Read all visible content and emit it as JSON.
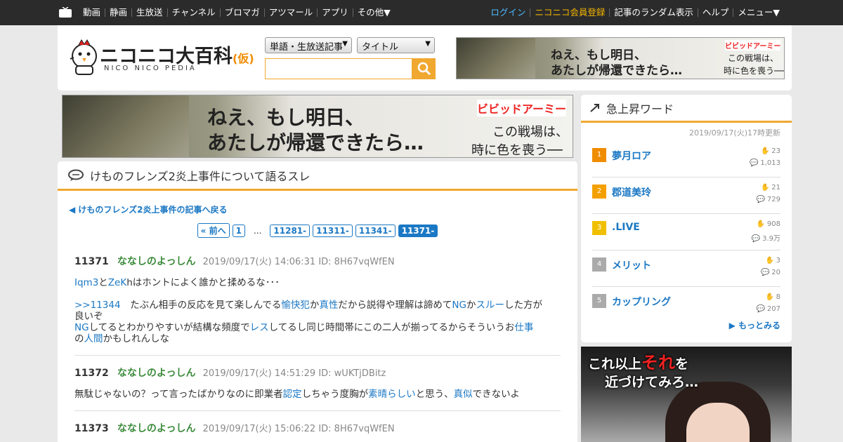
{
  "topnav": {
    "left": [
      "動画",
      "静画",
      "生放送",
      "チャンネル",
      "ブロマガ",
      "アツマール",
      "アプリ",
      "その他▼"
    ],
    "login": "ログイン",
    "register": "ニコニコ会員登録",
    "random": "記事のランダム表示",
    "help": "ヘルプ",
    "menu": "メニュー▼"
  },
  "logo": {
    "title": "ニコニコ大百科",
    "suffix": "(仮)",
    "sub": "NICO NICO PEDIA"
  },
  "search": {
    "scope": "単語・生放送記事",
    "field": "タイトル",
    "query": ""
  },
  "ad": {
    "line1": "ねえ、もし明日、",
    "line2": "あたしが帰還できたら…",
    "brand": "ビビッドアーミー",
    "tag1": "この戦場は、",
    "tag2": "時に色を喪う──"
  },
  "main": {
    "title": "けものフレンズ2炎上事件について語るスレ",
    "back": "◀ けものフレンズ2炎上事件の記事へ戻る",
    "pager": [
      "« 前へ",
      "1",
      "...",
      "11281-",
      "11311-",
      "11341-",
      "11371-"
    ],
    "posts": [
      {
        "num": "11371",
        "name": "ななしのよっしん",
        "meta": "2019/09/17(火) 14:06:31 ID: 8H67vqWfEN",
        "lines": [
          [
            "",
            "Iqm3",
            "と",
            "ZeK",
            "hはホントによく誰かと揉めるな･･･"
          ],
          [],
          [
            ">>11344",
            "　たぶん相手の反応を見て楽しんでる",
            "愉快犯",
            "か",
            "真性",
            "だから説得や理解は諦めて",
            "NG",
            "か",
            "スルー",
            "した方が"
          ],
          [
            "良いぞ"
          ],
          [
            "NG",
            "してるとわかりやすいが結構な頻度で",
            "レス",
            "してるし同じ時間帯にこの二人が揃ってるからそういうお",
            "仕事"
          ],
          [
            "の",
            "人間",
            "かもしれんしな"
          ]
        ]
      },
      {
        "num": "11372",
        "name": "ななしのよっしん",
        "meta": "2019/09/17(火) 14:51:29 ID: wUKTjDBitz",
        "lines": [
          [
            "無駄じゃないの？って言ったばかりなのに即業者",
            "認定",
            "しちゃう度胸が",
            "素晴らしい",
            "と思う、",
            "真似",
            "できないよ"
          ]
        ]
      },
      {
        "num": "11373",
        "name": "ななしのよっしん",
        "meta": "2019/09/17(火) 15:06:22 ID: 8H67vqWfEN",
        "lines": []
      }
    ]
  },
  "side": {
    "title": "急上昇ワード",
    "updated": "2019/09/17(火)17時更新",
    "ranks": [
      {
        "n": "1",
        "word": "夢月ロア",
        "a": "23",
        "b": "1,013",
        "color": "#f08c00"
      },
      {
        "n": "2",
        "word": "郡道美玲",
        "a": "21",
        "b": "729",
        "color": "#f4a000"
      },
      {
        "n": "3",
        "word": ".LIVE",
        "a": "908",
        "b": "3.9万",
        "color": "#f0c000"
      },
      {
        "n": "4",
        "word": "メリット",
        "a": "3",
        "b": "20",
        "color": "#aaaaaa"
      },
      {
        "n": "5",
        "word": "カップリング",
        "a": "8",
        "b": "207",
        "color": "#aaaaaa"
      }
    ],
    "more": "▶ もっとみる"
  },
  "sidead": {
    "l1": "これ以上",
    "red": "それ",
    "l1b": "を",
    "l2": "近づけてみろ…"
  }
}
